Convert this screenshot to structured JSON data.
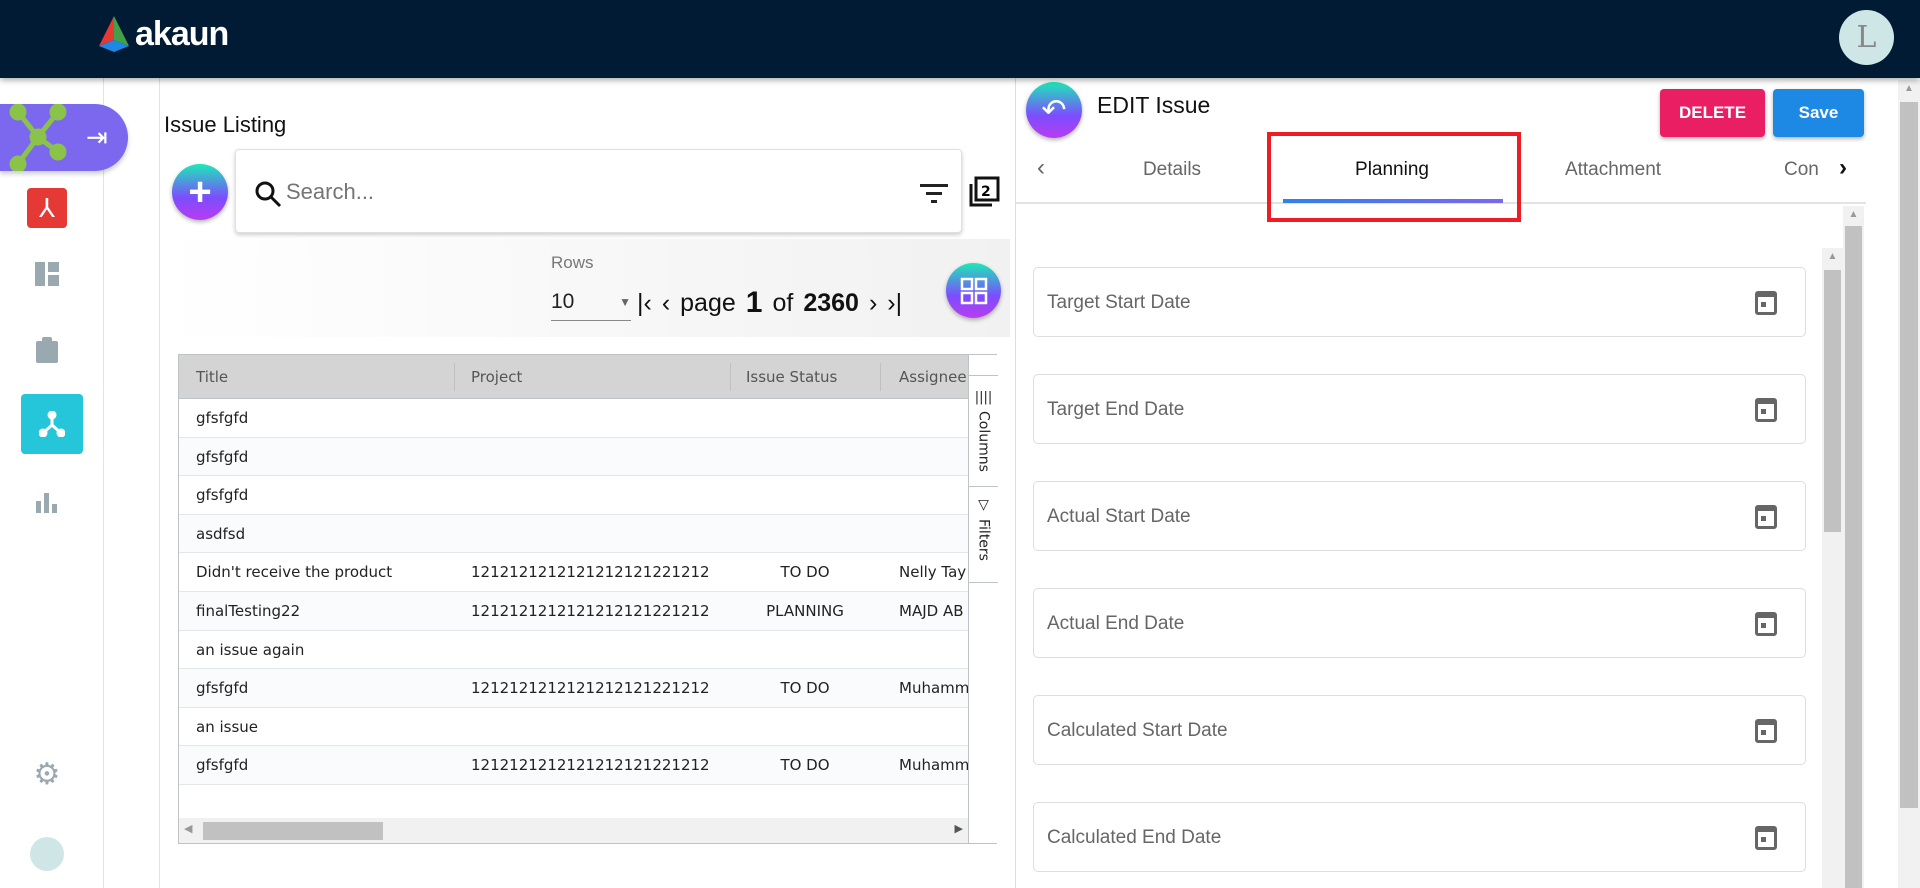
{
  "app": {
    "brand": "akaun",
    "user_avatar_letter": "L"
  },
  "sidebar": {
    "items": [
      "issue-tracker",
      "acrobat",
      "dashboard",
      "clipboard",
      "workflow",
      "reports",
      "settings",
      "profile"
    ]
  },
  "listing": {
    "title": "Issue Listing",
    "search": {
      "placeholder": "Search..."
    },
    "rows_label": "Rows",
    "rows_value": "10",
    "pager": {
      "page_word": "page",
      "current": "1",
      "of_word": "of",
      "total": "2360"
    },
    "columns": [
      "Title",
      "Project",
      "Issue Status",
      "Assignee"
    ],
    "rows": [
      [
        "gfsfgfd",
        "",
        "",
        ""
      ],
      [
        "gfsfgfd",
        "",
        "",
        ""
      ],
      [
        "gfsfgfd",
        "",
        "",
        ""
      ],
      [
        "asdfsd",
        "",
        "",
        ""
      ],
      [
        "Didn't receive the product",
        "1212121212121212121221212",
        "TO DO",
        "Nelly Tay"
      ],
      [
        "finalTesting22",
        "1212121212121212121221212",
        "PLANNING",
        "MAJD AB"
      ],
      [
        "an issue again",
        "",
        "",
        ""
      ],
      [
        "gfsfgfd",
        "1212121212121212121221212",
        "TO DO",
        "Muhamm"
      ],
      [
        "an issue",
        "",
        "",
        ""
      ],
      [
        "gfsfgfd",
        "1212121212121212121221212",
        "TO DO",
        "Muhamm"
      ]
    ],
    "side_panel": {
      "columns": "Columns",
      "filters": "Filters"
    }
  },
  "edit": {
    "title": "EDIT Issue",
    "delete_label": "DELETE",
    "save_label": "Save",
    "tabs": [
      "Details",
      "Planning",
      "Attachment",
      "Con"
    ],
    "active_tab": "Planning",
    "fields": [
      "Target Start Date",
      "Target End Date",
      "Actual Start Date",
      "Actual End Date",
      "Calculated Start Date",
      "Calculated End Date"
    ]
  },
  "colors": {
    "topbar": "#011b35",
    "delete": "#e91e63",
    "save": "#1e88e5",
    "highlight": "#ee1c25",
    "active_nav": "#7b68ee"
  }
}
